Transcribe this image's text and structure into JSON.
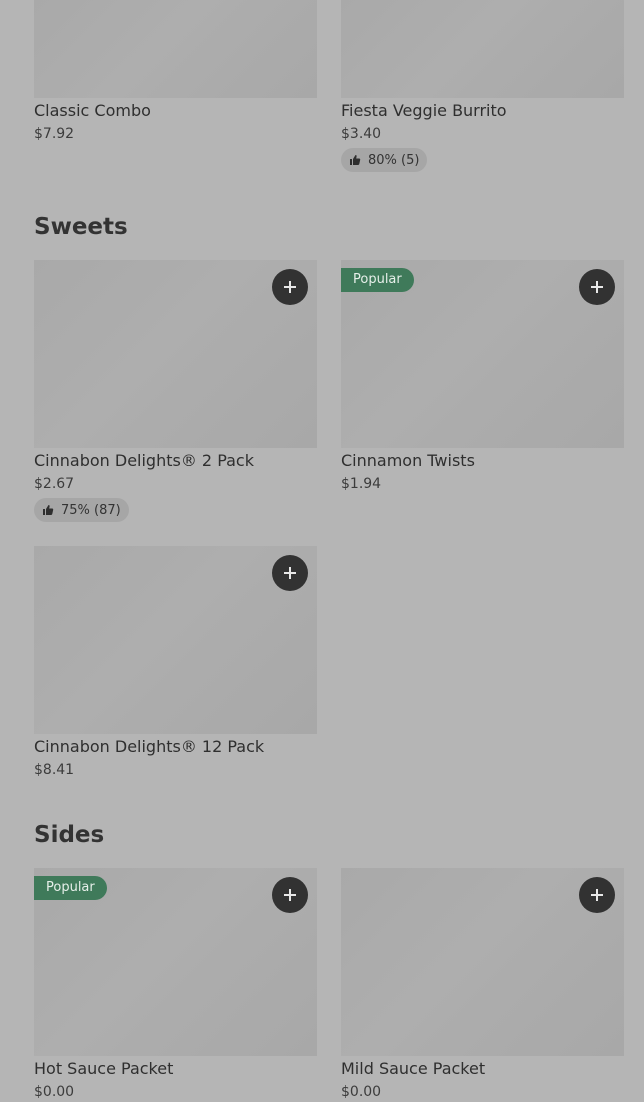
{
  "colors": {
    "background": "#b5b5b5",
    "image_placeholder": "#ababab",
    "popular_badge": "#3f7a5a",
    "add_button": "#323232",
    "rating_pill": "#a6a6a6"
  },
  "top_items": [
    {
      "name": "Classic Combo",
      "price": "$7.92"
    },
    {
      "name": "Fiesta Veggie Burrito",
      "price": "$3.40",
      "rating": "80% (5)"
    }
  ],
  "sweets": {
    "title": "Sweets",
    "items": [
      {
        "name": "Cinnabon Delights® 2 Pack",
        "price": "$2.67",
        "rating": "75% (87)"
      },
      {
        "name": "Cinnamon Twists",
        "price": "$1.94",
        "badge": "Popular"
      },
      {
        "name": "Cinnabon Delights® 12 Pack",
        "price": "$8.41"
      }
    ]
  },
  "sides": {
    "title": "Sides",
    "items": [
      {
        "name": "Hot Sauce Packet",
        "price": "$0.00",
        "badge": "Popular"
      },
      {
        "name": "Mild Sauce Packet",
        "price": "$0.00"
      }
    ]
  },
  "icons": {
    "add": "plus-icon",
    "rating": "thumbs-up-icon"
  }
}
